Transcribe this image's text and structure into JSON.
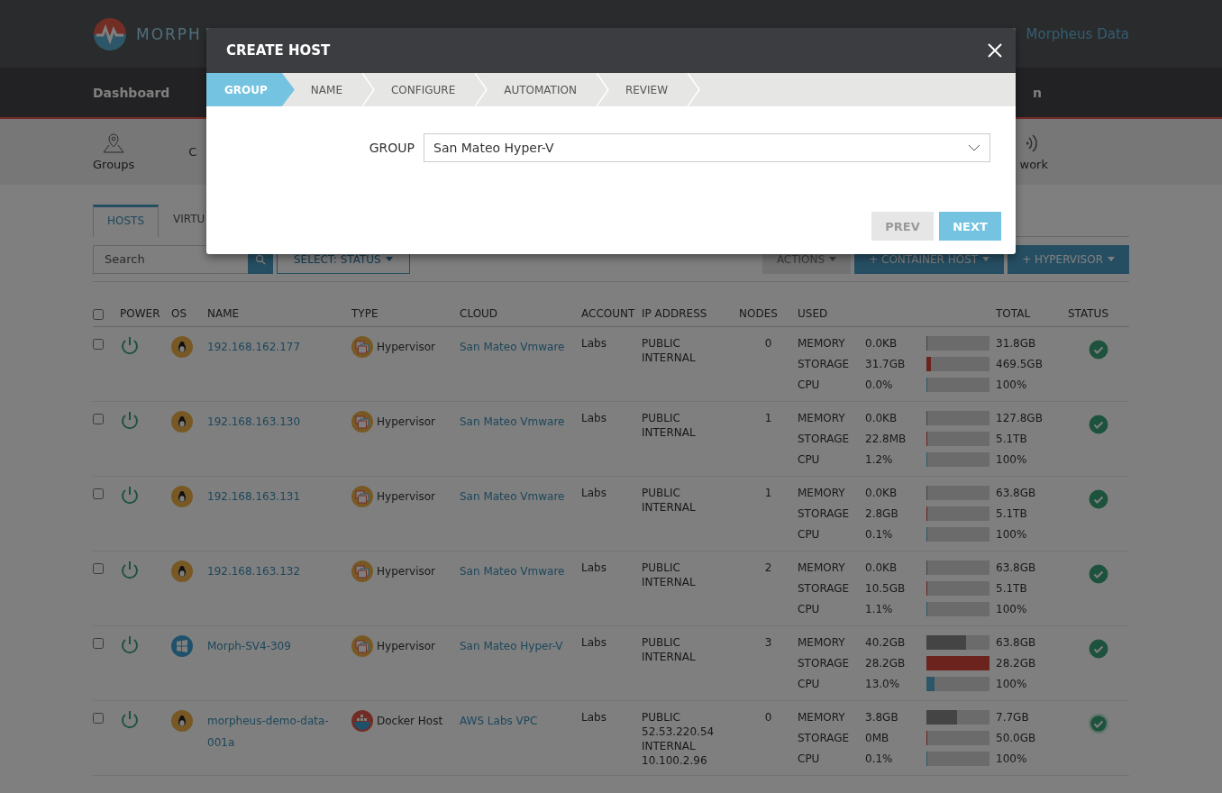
{
  "header": {
    "logo_text": "MORPH",
    "account": "Morpheus Data"
  },
  "nav": {
    "items": [
      "Dashboard",
      "n"
    ]
  },
  "subnav": {
    "items": [
      {
        "label": "Groups",
        "kind": "pin"
      },
      {
        "label": "C",
        "kind": "none"
      },
      {
        "label": "work",
        "kind": "signal"
      }
    ]
  },
  "tabs": [
    {
      "label": "HOSTS",
      "selected": true
    },
    {
      "label": "VIRTU",
      "selected": false
    }
  ],
  "toolbar": {
    "search": {
      "placeholder": "Search"
    },
    "status_filter": "SELECT: STATUS",
    "actions": "ACTIONS",
    "buttons": [
      "+ CONTAINER HOST",
      "+ HYPERVISOR"
    ]
  },
  "table": {
    "select_all": {
      "checked": false
    },
    "columns": [
      "POWER",
      "OS",
      "NAME",
      "TYPE",
      "CLOUD",
      "ACCOUNT",
      "IP ADDRESS",
      "NODES",
      "USED",
      "TOTAL",
      "STATUS"
    ],
    "rows": [
      {
        "checked": false,
        "os_icon": {
          "kind": "linux"
        },
        "name": [
          "192.168.162.177"
        ],
        "type": {
          "kind": "hypervisor",
          "label": "Hypervisor"
        },
        "cloud": "San Mateo Vmware",
        "account": "Labs",
        "ip": [
          "PUBLIC",
          "INTERNAL"
        ],
        "nodes": "0",
        "metrics": [
          {
            "label": "MEMORY",
            "used": "0.0KB",
            "level": 0,
            "total": "31.8GB"
          },
          {
            "label": "STORAGE",
            "used": "31.7GB",
            "level": 0.07,
            "total": "469.5GB"
          },
          {
            "label": "CPU",
            "used": "0.0%",
            "level": 0,
            "total": "100%"
          }
        ],
        "outlined": false
      },
      {
        "checked": false,
        "os_icon": {
          "kind": "linux"
        },
        "name": [
          "192.168.163.130"
        ],
        "type": {
          "kind": "hypervisor",
          "label": "Hypervisor"
        },
        "cloud": "San Mateo Vmware",
        "account": "Labs",
        "ip": [
          "PUBLIC",
          "INTERNAL"
        ],
        "nodes": "1",
        "metrics": [
          {
            "label": "MEMORY",
            "used": "0.0KB",
            "level": 0,
            "total": "127.8GB"
          },
          {
            "label": "STORAGE",
            "used": "22.8MB",
            "level": 0,
            "total": "5.1TB"
          },
          {
            "label": "CPU",
            "used": "1.2%",
            "level": 0.012,
            "total": "100%"
          }
        ],
        "outlined": false
      },
      {
        "checked": false,
        "os_icon": {
          "kind": "linux"
        },
        "name": [
          "192.168.163.131"
        ],
        "type": {
          "kind": "hypervisor",
          "label": "Hypervisor"
        },
        "cloud": "San Mateo Vmware",
        "account": "Labs",
        "ip": [
          "PUBLIC",
          "INTERNAL"
        ],
        "nodes": "1",
        "metrics": [
          {
            "label": "MEMORY",
            "used": "0.0KB",
            "level": 0,
            "total": "63.8GB"
          },
          {
            "label": "STORAGE",
            "used": "2.8GB",
            "level": 0,
            "total": "5.1TB"
          },
          {
            "label": "CPU",
            "used": "0.1%",
            "level": 0.001,
            "total": "100%"
          }
        ],
        "outlined": false
      },
      {
        "checked": false,
        "os_icon": {
          "kind": "linux"
        },
        "name": [
          "192.168.163.132"
        ],
        "type": {
          "kind": "hypervisor",
          "label": "Hypervisor"
        },
        "cloud": "San Mateo Vmware",
        "account": "Labs",
        "ip": [
          "PUBLIC",
          "INTERNAL"
        ],
        "nodes": "2",
        "metrics": [
          {
            "label": "MEMORY",
            "used": "0.0KB",
            "level": 0,
            "total": "63.8GB"
          },
          {
            "label": "STORAGE",
            "used": "10.5GB",
            "level": 0,
            "total": "5.1TB"
          },
          {
            "label": "CPU",
            "used": "1.1%",
            "level": 0.011,
            "total": "100%"
          }
        ],
        "outlined": false
      },
      {
        "checked": false,
        "os_icon": {
          "kind": "windows"
        },
        "name": [
          "Morph-SV4-309"
        ],
        "type": {
          "kind": "hypervisor",
          "label": "Hypervisor"
        },
        "cloud": "San Mateo Hyper-V",
        "account": "Labs",
        "ip": [
          "PUBLIC",
          "INTERNAL"
        ],
        "nodes": "3",
        "metrics": [
          {
            "label": "MEMORY",
            "used": "40.2GB",
            "level": 0.63,
            "total": "63.8GB"
          },
          {
            "label": "STORAGE",
            "used": "28.2GB",
            "level": 1,
            "total": "28.2GB"
          },
          {
            "label": "CPU",
            "used": "13.0%",
            "level": 0.13,
            "total": "100%"
          }
        ],
        "outlined": false
      },
      {
        "checked": false,
        "os_icon": {
          "kind": "linux"
        },
        "name": [
          "morpheus-demo-data-",
          "001a"
        ],
        "type": {
          "kind": "docker",
          "label": "Docker Host"
        },
        "cloud": "AWS Labs VPC",
        "account": "Labs",
        "ip": [
          "PUBLIC",
          "52.53.220.54",
          "INTERNAL",
          "10.100.2.96"
        ],
        "nodes": "0",
        "metrics": [
          {
            "label": "MEMORY",
            "used": "3.8GB",
            "level": 0.49,
            "total": "7.7GB"
          },
          {
            "label": "STORAGE",
            "used": "0MB",
            "level": 0,
            "total": "50.0GB"
          },
          {
            "label": "CPU",
            "used": "0.1%",
            "level": 0.001,
            "total": "100%"
          }
        ],
        "outlined": true
      }
    ]
  },
  "modal": {
    "title": "CREATE HOST",
    "steps": [
      {
        "label": "GROUP",
        "selected": true
      },
      {
        "label": "NAME",
        "selected": false
      },
      {
        "label": "CONFIGURE",
        "selected": false
      },
      {
        "label": "AUTOMATION",
        "selected": false
      },
      {
        "label": "REVIEW",
        "selected": false
      }
    ],
    "field": {
      "label": "GROUP",
      "value": "San Mateo Hyper-V"
    },
    "buttons": [
      {
        "label": "PREV",
        "disabled": true
      },
      {
        "label": "NEXT",
        "disabled": false
      }
    ]
  }
}
